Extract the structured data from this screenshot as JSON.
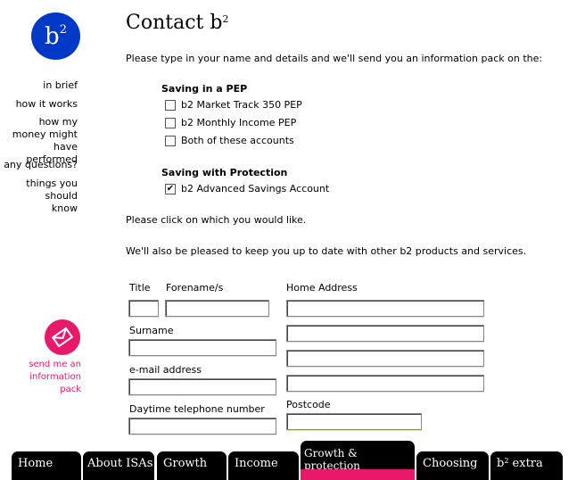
{
  "logo": {
    "letter": "b",
    "superscript": "2"
  },
  "sidebar": {
    "items": [
      {
        "label": "in brief"
      },
      {
        "label": "how it works"
      },
      {
        "label": "how my money might have performed"
      },
      {
        "label": "any questions?"
      },
      {
        "label": "things you should know"
      }
    ],
    "send_pack_label": "send me an information pack"
  },
  "page": {
    "title_main": "Contact b",
    "title_sup": "2",
    "intro": "Please type in your name and details and we'll send you an information pack on the:",
    "section_pep": "Saving in a PEP",
    "pep_options": [
      {
        "label": "b2 Market Track 350 PEP",
        "checked": false
      },
      {
        "label": "b2 Monthly Income PEP",
        "checked": false
      },
      {
        "label": "Both of these accounts",
        "checked": false
      }
    ],
    "section_protection": "Saving with Protection",
    "protection_options": [
      {
        "label": "b2 Advanced Savings Account",
        "checked": true
      }
    ],
    "click_instruction": "Please click on which you would like.",
    "update_note": "We'll also be pleased to keep you up to date with other b2 products and services."
  },
  "form": {
    "title_label": "Title",
    "forename_label": "Forename/s",
    "surname_label": "Surname",
    "email_label": "e-mail address",
    "phone_label": "Daytime telephone number",
    "address_label": "Home Address",
    "postcode_label": "Postcode",
    "values": {
      "title": "",
      "forename": "",
      "surname": "",
      "email": "",
      "phone": "",
      "address1": "",
      "address2": "",
      "address3": "",
      "address4": "",
      "postcode": ""
    }
  },
  "tabs": [
    {
      "label": "Home"
    },
    {
      "label": "About ISAs"
    },
    {
      "label": "Growth"
    },
    {
      "label": "Income"
    },
    {
      "label": "Growth & protection",
      "active": true
    },
    {
      "label": "Choosing"
    },
    {
      "label": "b",
      "sup": "2",
      "suffix": " extra"
    }
  ],
  "colors": {
    "logo_blue": "#0038c8",
    "accent_pink": "#e8186a",
    "tab_black": "#000000"
  }
}
